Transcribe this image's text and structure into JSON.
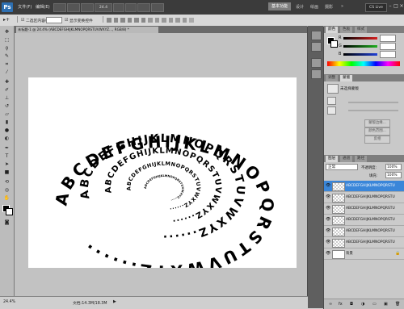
{
  "app": {
    "logo": "Ps",
    "menu": [
      "文件(F)",
      "编辑(E)",
      "图像(I)",
      "图层(L)",
      "选择(S)",
      "滤镜(T)",
      "分析(A)",
      "3D(D)",
      "视图(V)",
      "窗口(W)",
      "帮助(H)"
    ],
    "zoom": "24.4",
    "workspace": "基本功能",
    "workspace_links": [
      "设计",
      "绘画",
      "摄影"
    ],
    "cs_live": "CS Live",
    "window_controls": [
      "–",
      "□",
      "×"
    ]
  },
  "options_bar": {
    "items": [
      "二选区内容格",
      "显示变换控件"
    ]
  },
  "document": {
    "tab_title": "未标题-1 @ 24.4% (ABCDEFGHIJKLMNOPQRSTUVWXYZ..., RGB/8) *"
  },
  "canvas": {
    "rings": [
      "ABCDEFGHIJKLMNOPQRSTUVWXYZ......",
      "ABCDEFGHIJKLMNOPQRSTUVWXYZ......",
      "ABCDEFGHIJKLMNOPQRSTUVWXYZ......",
      "ABCDEFGHIJKLMNOPQRSTUVWXYZ......",
      "ABCDEFGHIJKLMNOPQRSTUVWXYZ......"
    ]
  },
  "status": {
    "zoom": "24.4%",
    "doc": "文档:14.3M/18.3M"
  },
  "panels": {
    "color_tabs": [
      "颜色",
      "色板",
      "样式"
    ],
    "channels": [
      "R",
      "G",
      "B"
    ],
    "adjust_tabs": [
      "调整",
      "蒙版"
    ],
    "adjust_title": "未选择蒙版",
    "adjust_buttons": [
      "蒙版边缘...",
      "颜色范围...",
      "反相"
    ],
    "layers_tabs": [
      "图层",
      "通道",
      "路径"
    ],
    "blend_mode": "正常",
    "opacity_label": "不透明度:",
    "opacity_value": "100%",
    "fill_label": "填充:",
    "fill_value": "100%",
    "layers": [
      {
        "name": "ABCDEFGHIJKLMNOPQRSTU",
        "selected": true
      },
      {
        "name": "ABCDEFGHIJKLMNOPQRSTU",
        "selected": false
      },
      {
        "name": "ABCDEFGHIJKLMNOPQRSTU",
        "selected": false
      },
      {
        "name": "ABCDEFGHIJKLMNOPQRSTU",
        "selected": false
      },
      {
        "name": "ABCDEFGHIJKLMNOPQRSTU",
        "selected": false
      },
      {
        "name": "ABCDEFGHIJKLMNOPQRSTU",
        "selected": false
      },
      {
        "name": "背景",
        "selected": false
      }
    ]
  },
  "colors": {
    "accent": "#3a86d9",
    "red_track": "#d82020",
    "green_track": "#20b020",
    "blue_track": "#2040d8"
  }
}
